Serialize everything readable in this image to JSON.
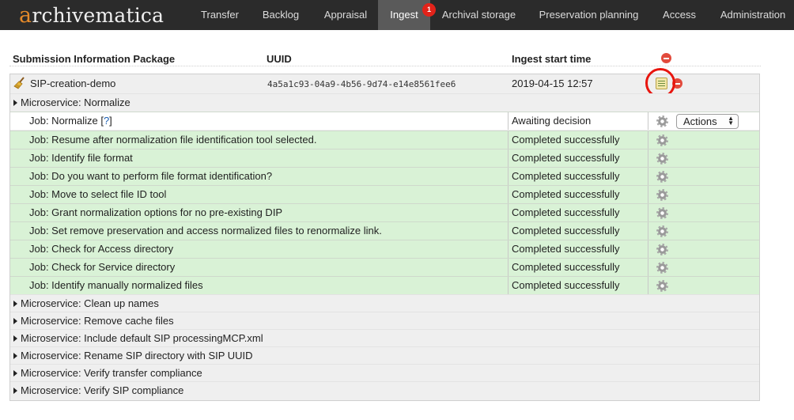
{
  "app": {
    "logo_first": "a",
    "logo_rest": "rchivematica",
    "accent": "#e58a2a"
  },
  "nav": {
    "items": [
      {
        "label": "Transfer"
      },
      {
        "label": "Backlog"
      },
      {
        "label": "Appraisal"
      },
      {
        "label": "Ingest"
      },
      {
        "label": "Archival storage"
      },
      {
        "label": "Preservation planning"
      },
      {
        "label": "Access"
      },
      {
        "label": "Administration"
      }
    ],
    "active": "Ingest",
    "ingest_badge": "1"
  },
  "table": {
    "headers": {
      "sip": "Submission Information Package",
      "uuid": "UUID",
      "start": "Ingest start time"
    }
  },
  "sip": {
    "name": "SIP-creation-demo",
    "uuid": "4a5a1c93-04a9-4b56-9d74-e14e8561fee6",
    "start_time": "2019-04-15 12:57"
  },
  "microservice_open": {
    "label": "Microservice: Normalize",
    "jobs": [
      {
        "name": "Job: Normalize",
        "status": "Awaiting decision"
      },
      {
        "name": "Job: Resume after normalization file identification tool selected.",
        "status": "Completed successfully"
      },
      {
        "name": "Job: Identify file format",
        "status": "Completed successfully"
      },
      {
        "name": "Job: Do you want to perform file format identification?",
        "status": "Completed successfully"
      },
      {
        "name": "Job: Move to select file ID tool",
        "status": "Completed successfully"
      },
      {
        "name": "Job: Grant normalization options for no pre-existing DIP",
        "status": "Completed successfully"
      },
      {
        "name": "Job: Set remove preservation and access normalized files to renormalize link.",
        "status": "Completed successfully"
      },
      {
        "name": "Job: Check for Access directory",
        "status": "Completed successfully"
      },
      {
        "name": "Job: Check for Service directory",
        "status": "Completed successfully"
      },
      {
        "name": "Job: Identify manually normalized files",
        "status": "Completed successfully"
      }
    ],
    "help_link": "?",
    "actions_label": "Actions"
  },
  "microservices_collapsed": [
    {
      "label": "Microservice: Clean up names"
    },
    {
      "label": "Microservice: Remove cache files"
    },
    {
      "label": "Microservice: Include default SIP processingMCP.xml"
    },
    {
      "label": "Microservice: Rename SIP directory with SIP UUID"
    },
    {
      "label": "Microservice: Verify transfer compliance"
    },
    {
      "label": "Microservice: Verify SIP compliance"
    }
  ],
  "icons": {
    "broom": "broom-icon",
    "remove": "remove-icon",
    "metadata": "metadata-icon",
    "gear": "gear-icon"
  },
  "colors": {
    "completed_bg": "#d9f2d6",
    "remove_red": "#e24a3c",
    "highlight": "#e8150e"
  }
}
